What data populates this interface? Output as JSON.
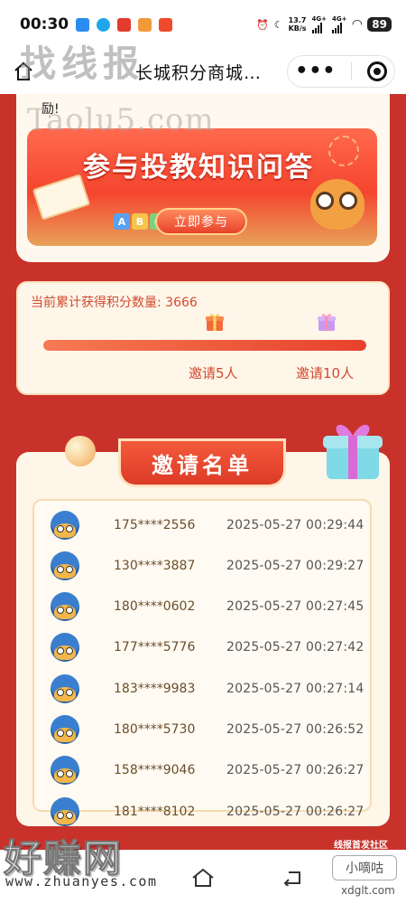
{
  "status_bar": {
    "time": "00:30",
    "network_speed": "13.7\nKB/s",
    "network_top": "13.7",
    "network_unit": "KB/s",
    "signal_a": "4G+",
    "signal_b": "4G+",
    "battery": "89"
  },
  "nav": {
    "title": "长城积分商城…",
    "more_label": "•••"
  },
  "watermarks": {
    "top": "找线报",
    "taolu": "Taolu5.com",
    "haozhuan": "好赚网",
    "zhuanyes": "www.zhuanyes.com",
    "community": "线报首发社区",
    "xiaodigu": "小嘀咕",
    "xdglt": "xdglt.com"
  },
  "card1": {
    "text_tail": "励!",
    "banner_title": "参与投教知识问答",
    "banner_button": "立即参与"
  },
  "progress": {
    "label": "当前累计获得积分数量: 3666",
    "fill_fraction": 1.0,
    "milestones": [
      "邀请5人",
      "邀请10人"
    ]
  },
  "invite_list": {
    "title": "邀请名单",
    "rows": [
      {
        "phone": "175****2556",
        "time": "2025-05-27 00:29:44"
      },
      {
        "phone": "130****3887",
        "time": "2025-05-27 00:29:27"
      },
      {
        "phone": "180****0602",
        "time": "2025-05-27 00:27:45"
      },
      {
        "phone": "177****5776",
        "time": "2025-05-27 00:27:42"
      },
      {
        "phone": "183****9983",
        "time": "2025-05-27 00:27:14"
      },
      {
        "phone": "180****5730",
        "time": "2025-05-27 00:26:52"
      },
      {
        "phone": "158****9046",
        "time": "2025-05-27 00:26:27"
      },
      {
        "phone": "181****8102",
        "time": "2025-05-27 00:26:27"
      }
    ]
  },
  "colors": {
    "page_bg": "#c8322a",
    "accent": "#e8412c",
    "card_bg": "#fff6ea",
    "milestone_text": "#d04a2e"
  }
}
